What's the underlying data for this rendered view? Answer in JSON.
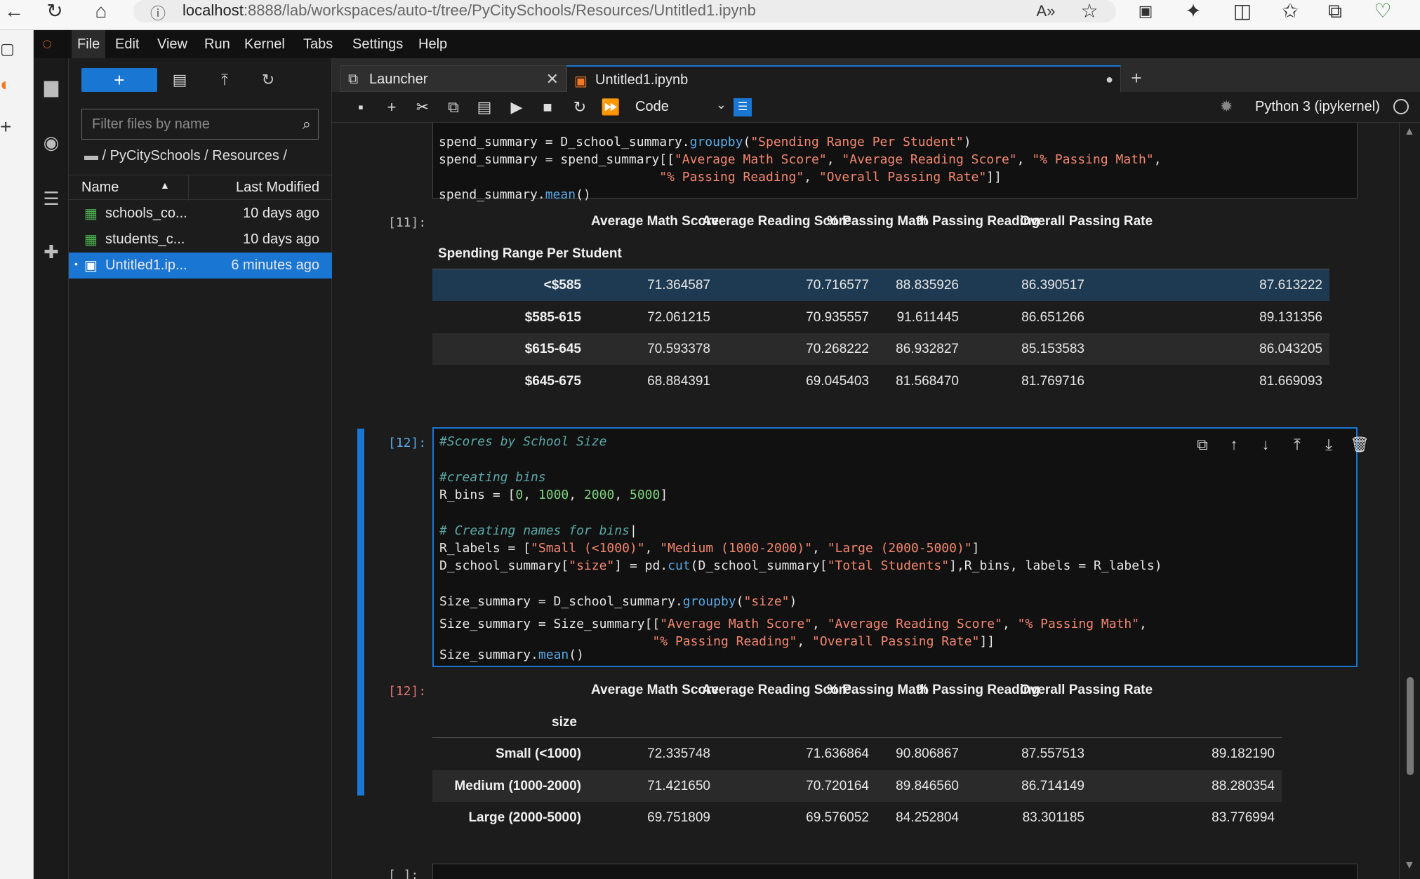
{
  "browser": {
    "url_host": "localhost",
    "url_rest": ":8888/lab/workspaces/auto-t/tree/PyCitySchools/Resources/Untitled1.ipynb"
  },
  "menu": [
    "File",
    "Edit",
    "View",
    "Run",
    "Kernel",
    "Tabs",
    "Settings",
    "Help"
  ],
  "filebrowser": {
    "filter_placeholder": "Filter files by name",
    "breadcrumb": "/ PyCitySchools / Resources /",
    "col_name": "Name",
    "col_modified": "Last Modified",
    "files": [
      {
        "name": "schools_co...",
        "modified": "10 days ago"
      },
      {
        "name": "students_c...",
        "modified": "10 days ago"
      },
      {
        "name": "Untitled1.ip...",
        "modified": "6 minutes ago"
      }
    ]
  },
  "tabs": [
    {
      "label": "Launcher"
    },
    {
      "label": "Untitled1.ipynb"
    }
  ],
  "toolbar": {
    "cell_type": "Code",
    "kernel": "Python 3 (ipykernel)"
  },
  "cells": {
    "top_code": [
      "spend_summary = D_school_summary.groupby(\"Spending Range Per Student\")",
      "spend_summary = spend_summary[[\"Average Math Score\", \"Average Reading Score\", \"% Passing Math\",",
      "                             \"% Passing Reading\", \"Overall Passing Rate\"]]",
      "spend_summary.mean()"
    ],
    "out11_prompt": "[11]:",
    "in12_prompt": "[12]:",
    "out12_prompt": "[12]:",
    "next_prompt": "[ ]:"
  },
  "df11": {
    "columns": [
      "Average Math Score",
      "Average Reading Score",
      "% Passing Math",
      "% Passing Reading",
      "Overall Passing Rate"
    ],
    "index_name": "Spending Range Per Student",
    "rows": [
      {
        "idx": "<$585",
        "vals": [
          "71.364587",
          "70.716577",
          "88.835926",
          "86.390517",
          "87.613222"
        ]
      },
      {
        "idx": "$585-615",
        "vals": [
          "72.061215",
          "70.935557",
          "91.611445",
          "86.651266",
          "89.131356"
        ]
      },
      {
        "idx": "$615-645",
        "vals": [
          "70.593378",
          "70.268222",
          "86.932827",
          "85.153583",
          "86.043205"
        ]
      },
      {
        "idx": "$645-675",
        "vals": [
          "68.884391",
          "69.045403",
          "81.568470",
          "81.769716",
          "81.669093"
        ]
      }
    ]
  },
  "df12": {
    "columns": [
      "Average Math Score",
      "Average Reading Score",
      "% Passing Math",
      "% Passing Reading",
      "Overall Passing Rate"
    ],
    "index_name": "size",
    "rows": [
      {
        "idx": "Small (<1000)",
        "vals": [
          "72.335748",
          "71.636864",
          "90.806867",
          "87.557513",
          "89.182190"
        ]
      },
      {
        "idx": "Medium (1000-2000)",
        "vals": [
          "71.421650",
          "70.720164",
          "89.846560",
          "86.714149",
          "88.280354"
        ]
      },
      {
        "idx": "Large (2000-5000)",
        "vals": [
          "69.751809",
          "69.576052",
          "84.252804",
          "83.301185",
          "83.776994"
        ]
      }
    ]
  }
}
